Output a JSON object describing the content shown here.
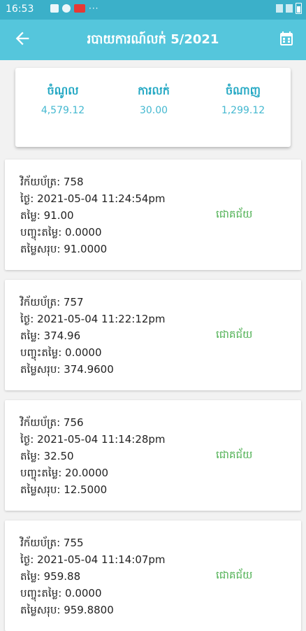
{
  "status_bar": {
    "time": "16:53",
    "dots": "···"
  },
  "app_bar": {
    "title": "របាយការណ៍លក់ 5/2021",
    "back_icon": "arrow-left-icon",
    "calendar_icon": "calendar-icon"
  },
  "summary": {
    "income_label": "ចំណូល",
    "income_value": "4,579.12",
    "sales_label": "ការលក់",
    "sales_value": "30.00",
    "expense_label": "ចំណាញ",
    "expense_value": "1,299.12"
  },
  "invoices": [
    {
      "invoice": "វិក័យប័ត្រ: 758",
      "date": "ថ្ងៃ: 2021-05-04 11:24:54pm",
      "price": "តម្លៃ: 91.00",
      "discount": "បញ្ចុះតម្លៃ: 0.0000",
      "total": "តម្លៃសរុប: 91.0000",
      "status": "ជោគជ័យ"
    },
    {
      "invoice": "វិក័យប័ត្រ: 757",
      "date": "ថ្ងៃ: 2021-05-04 11:22:12pm",
      "price": "តម្លៃ: 374.96",
      "discount": "បញ្ចុះតម្លៃ: 0.0000",
      "total": "តម្លៃសរុប: 374.9600",
      "status": "ជោគជ័យ"
    },
    {
      "invoice": "វិក័យប័ត្រ: 756",
      "date": "ថ្ងៃ: 2021-05-04 11:14:28pm",
      "price": "តម្លៃ: 32.50",
      "discount": "បញ្ចុះតម្លៃ: 20.0000",
      "total": "តម្លៃសរុប: 12.5000",
      "status": "ជោគជ័យ"
    },
    {
      "invoice": "វិក័យប័ត្រ: 755",
      "date": "ថ្ងៃ: 2021-05-04 11:14:07pm",
      "price": "តម្លៃ: 959.88",
      "discount": "បញ្ចុះតម្លៃ: 0.0000",
      "total": "តម្លៃសរុប: 959.8800",
      "status": "ជោគជ័យ"
    }
  ]
}
